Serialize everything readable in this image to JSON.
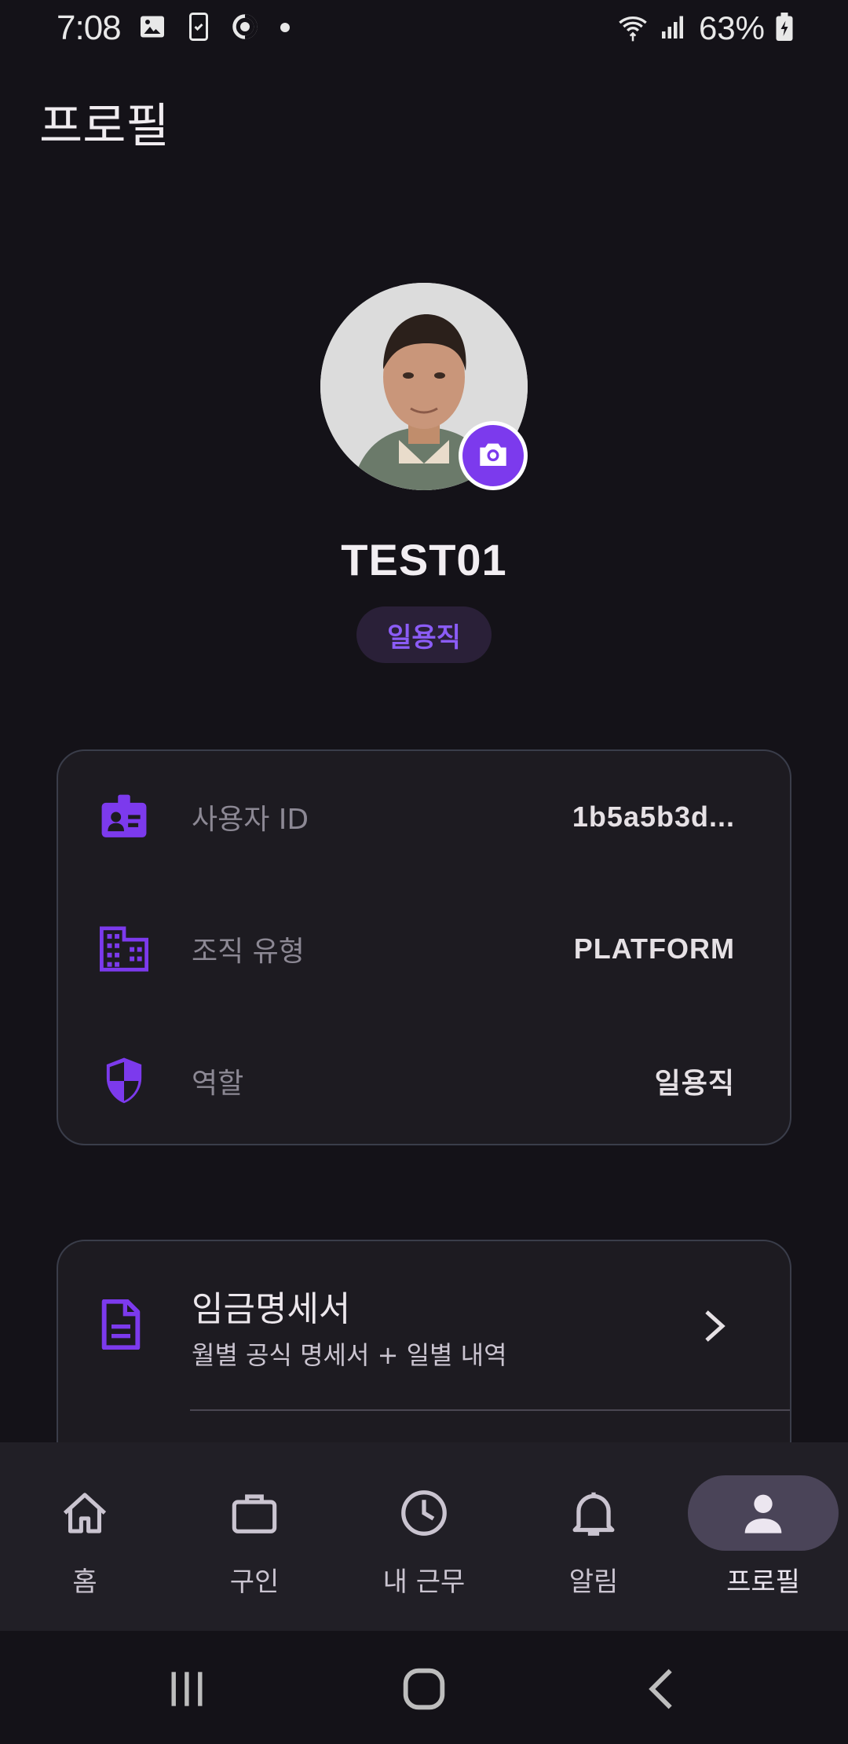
{
  "status_bar": {
    "time": "7:08",
    "battery": "63%",
    "icons": [
      "image-icon",
      "sim-icon",
      "sync-icon",
      "dot-icon",
      "wifi-icon",
      "signal-icon",
      "battery-icon"
    ]
  },
  "header": {
    "title": "프로필"
  },
  "profile": {
    "name": "TEST01",
    "role_badge": "일용직",
    "accent_color": "#7c3aed"
  },
  "info_card": {
    "rows": [
      {
        "label": "사용자 ID",
        "value": "1b5a5b3d...",
        "icon": "id-badge-icon"
      },
      {
        "label": "조직 유형",
        "value": "PLATFORM",
        "icon": "building-icon"
      },
      {
        "label": "역할",
        "value": "일용직",
        "icon": "shield-icon"
      }
    ]
  },
  "menu": {
    "items": [
      {
        "title": "임금명세서",
        "subtitle": "월별 공식 명세서 + 일별 내역",
        "icon": "document-icon"
      }
    ]
  },
  "bottom_nav": {
    "items": [
      {
        "label": "홈",
        "icon": "home-icon"
      },
      {
        "label": "구인",
        "icon": "briefcase-icon"
      },
      {
        "label": "내 근무",
        "icon": "clock-icon"
      },
      {
        "label": "알림",
        "icon": "bell-icon"
      },
      {
        "label": "프로필",
        "icon": "person-icon",
        "active": true
      }
    ]
  },
  "system_nav": {
    "buttons": [
      "recents-button",
      "home-button",
      "back-button"
    ]
  }
}
